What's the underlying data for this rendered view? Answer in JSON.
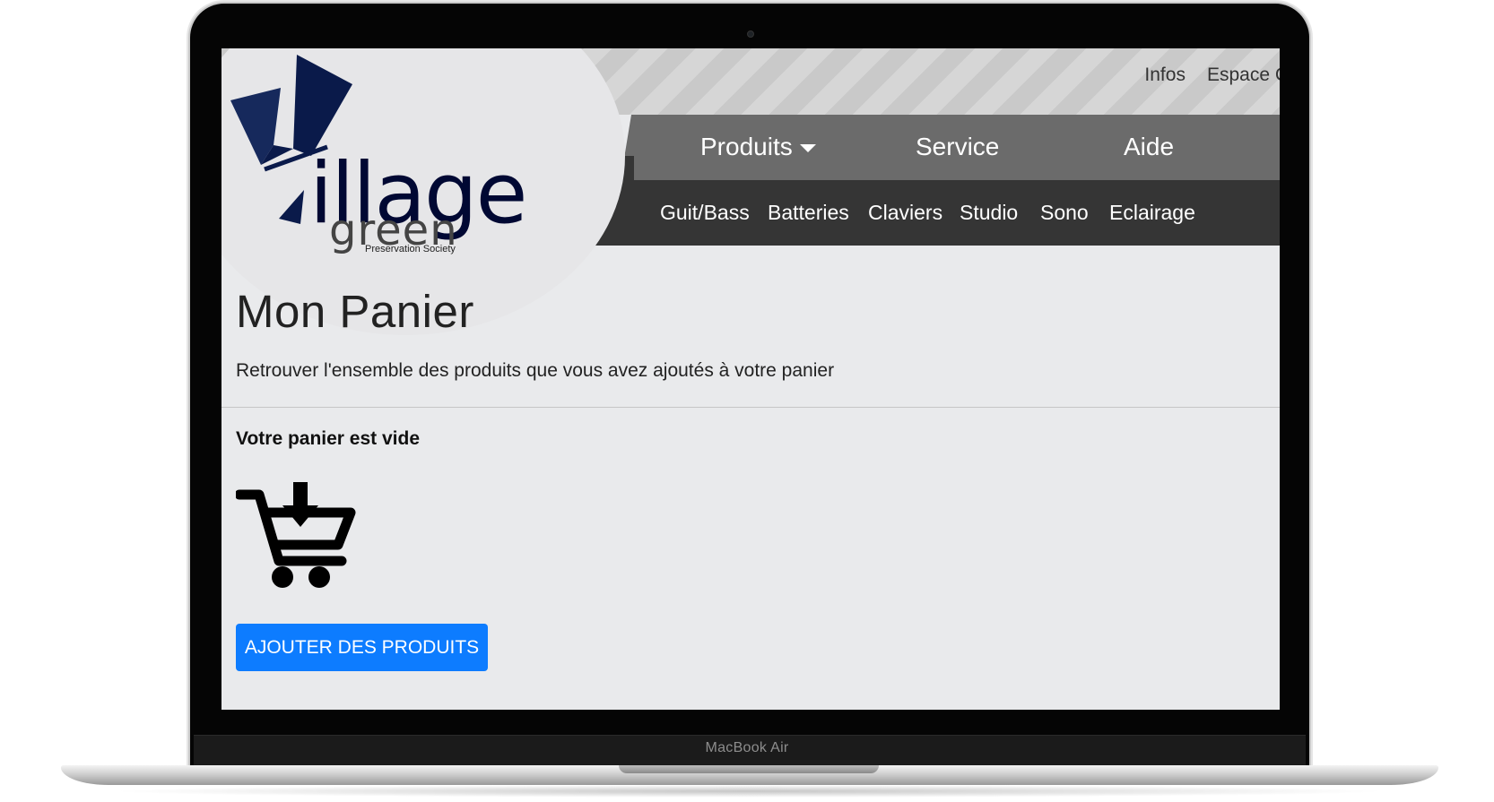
{
  "device": {
    "label": "MacBook Air"
  },
  "header": {
    "top_links": [
      "Infos",
      "Espace C"
    ],
    "menu": [
      {
        "label": "Produits",
        "dropdown": true
      },
      {
        "label": "Service"
      },
      {
        "label": "Aide"
      }
    ],
    "submenu": [
      "Guit/Bass",
      "Batteries",
      "Claviers",
      "Studio",
      "Sono",
      "Eclairage"
    ]
  },
  "logo": {
    "word": "illage",
    "second": "green",
    "tagline": "Preservation Society"
  },
  "main": {
    "title": "Mon Panier",
    "subtitle": "Retrouver l'ensemble des produits que vous avez ajoutés à votre panier",
    "empty_message": "Votre panier est vide",
    "cart_icon": "cart-download-icon",
    "add_button": "AJOUTER DES PRODUITS"
  },
  "colors": {
    "accent": "#0d7cff",
    "logo_navy": "#000833",
    "menu_bg": "#6b6b6b",
    "submenu_bg": "#353535"
  }
}
